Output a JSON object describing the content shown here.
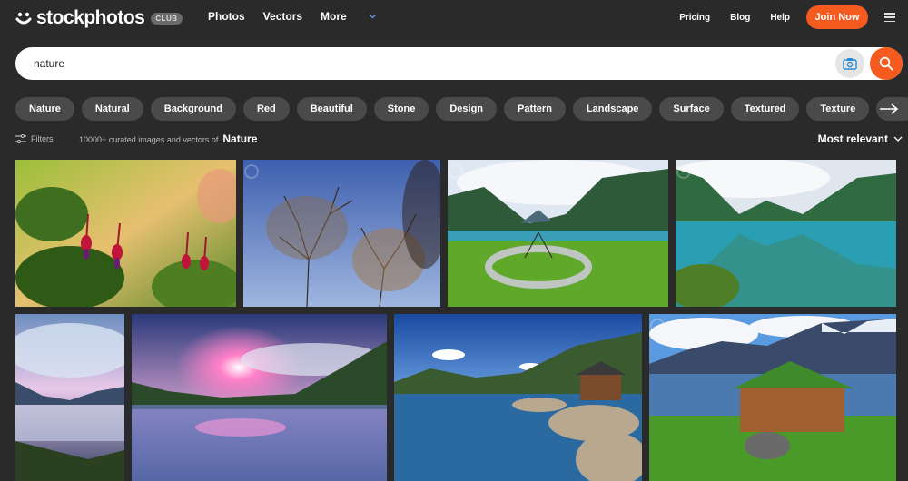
{
  "brand": {
    "name": "stockphotos",
    "badge": "CLUB"
  },
  "nav": {
    "left": [
      {
        "label": "Photos"
      },
      {
        "label": "Vectors"
      },
      {
        "label": "More"
      }
    ],
    "right": [
      {
        "label": "Pricing"
      },
      {
        "label": "Blog"
      },
      {
        "label": "Help"
      }
    ],
    "join_label": "Join Now",
    "accent": "#f55a1f"
  },
  "search": {
    "value": "nature"
  },
  "tags": [
    "Nature",
    "Natural",
    "Background",
    "Red",
    "Beautiful",
    "Stone",
    "Design",
    "Pattern",
    "Landscape",
    "Surface",
    "Textured",
    "Texture"
  ],
  "filters": {
    "label": "Filters",
    "summary": "10000+ curated images and vectors of",
    "query": "Nature",
    "sort": "Most relevant"
  },
  "icons": {
    "logo": "stockphotos-logo-icon",
    "more": "chevron-down-icon",
    "menu": "hamburger-menu-icon",
    "camera": "camera-search-icon",
    "search": "search-icon",
    "next": "arrow-right-icon",
    "filters": "sliders-icon",
    "sort": "chevron-down-icon"
  }
}
